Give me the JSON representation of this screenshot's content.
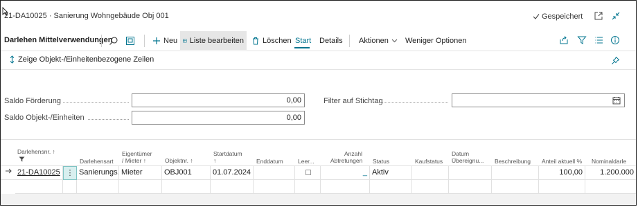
{
  "window": {
    "title": "21-DA10025 · Sanierung Wohngebäude Obj 001",
    "saved_status": "Gespeichert"
  },
  "actionbar": {
    "caption": "Darlehen Mittelverwendungen",
    "new_label": "Neu",
    "edit_list_label": "Liste bearbeiten",
    "delete_label": "Löschen",
    "start_label": "Start",
    "details_label": "Details",
    "actions_label": "Aktionen",
    "fewer_options_label": "Weniger Optionen"
  },
  "toggle": {
    "label": "Zeige Objekt-/Einheitenbezogene Zeilen"
  },
  "fields": {
    "saldo_foerderung": {
      "label": "Saldo Förderung",
      "value": "0,00"
    },
    "saldo_objekt": {
      "label": "Saldo Objekt-/Einheiten",
      "value": "0,00"
    },
    "filter_stichtag": {
      "label": "Filter auf Stichtag",
      "value": ""
    }
  },
  "grid": {
    "headers": {
      "darlehensnr": "Darlehensnr. ↑",
      "darlehensart": "Darlehensart",
      "eigentuemer_1": "Eigentümer",
      "eigentuemer_2": "/ Mieter ↑",
      "objektnr": "Objektnr. ↑",
      "startdatum_1": "Startdatum",
      "startdatum_2": "↑",
      "enddatum": "Enddatum",
      "leer": "Leer...",
      "anzahl_1": "Anzahl",
      "anzahl_2": "Abtretungen",
      "status": "Status",
      "kaufstatus": "Kaufstatus",
      "datum_1": "Datum",
      "datum_2": "Übereignu...",
      "beschreibung": "Beschreibung",
      "anteil": "Anteil aktuell %",
      "nominal": "Nominaldarle"
    },
    "rows": [
      {
        "darlehensnr": "21-DA10025",
        "darlehensart": "Sanierungs...",
        "eigentuemer": "Mieter",
        "objektnr": "OBJ001",
        "startdatum": "01.07.2024",
        "enddatum": "",
        "anzahl": "_",
        "status": "Aktiv",
        "kaufstatus": "",
        "datum": "",
        "beschreibung": "",
        "anteil": "100,00",
        "nominal": "1.200.000"
      }
    ]
  },
  "colors": {
    "accent": "#00748f",
    "selection": "#d8efef",
    "border": "#8a8a8a"
  }
}
